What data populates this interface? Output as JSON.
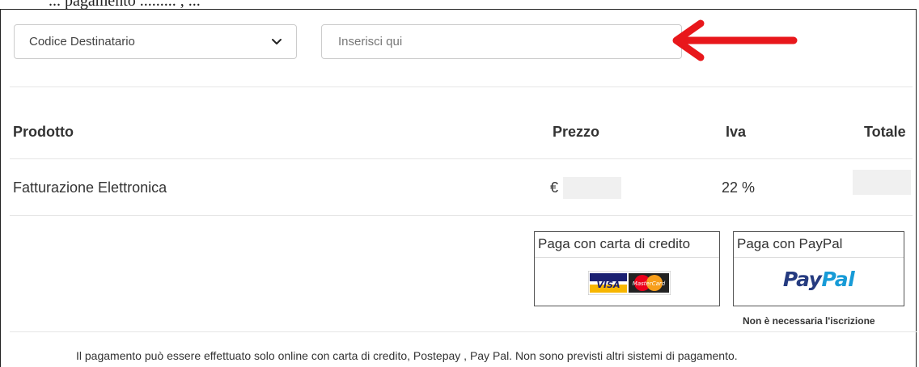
{
  "top_cut_text": "... pagamento ......... , ...",
  "invoice": {
    "recipient_select": {
      "selected": "Codice Destinatario"
    },
    "recipient_input": {
      "placeholder": "Inserisci qui",
      "value": ""
    }
  },
  "table": {
    "headers": {
      "product": "Prodotto",
      "price": "Prezzo",
      "vat": "Iva",
      "total": "Totale"
    },
    "rows": [
      {
        "product": "Fatturazione Elettronica",
        "price_currency": "€",
        "vat": "22 %"
      }
    ]
  },
  "payment": {
    "card": {
      "title": "Paga con carta di credito",
      "logo_visa": "VISA",
      "logo_mastercard": "MasterCard"
    },
    "paypal": {
      "title": "Paga con PayPal",
      "logo_pay": "Pay",
      "logo_pal": "Pal",
      "note": "Non è necessaria l'iscrizione"
    }
  },
  "footer": "Il pagamento può essere effettuato solo online con carta di credito, Postepay , Pay Pal. Non sono previsti altri sistemi di pagamento.",
  "colors": {
    "annotation_arrow": "#e8171b",
    "paypal_dark": "#253b80",
    "paypal_light": "#179bd7"
  },
  "icons": [
    "chevron-down-icon",
    "annotation-arrow-icon"
  ]
}
